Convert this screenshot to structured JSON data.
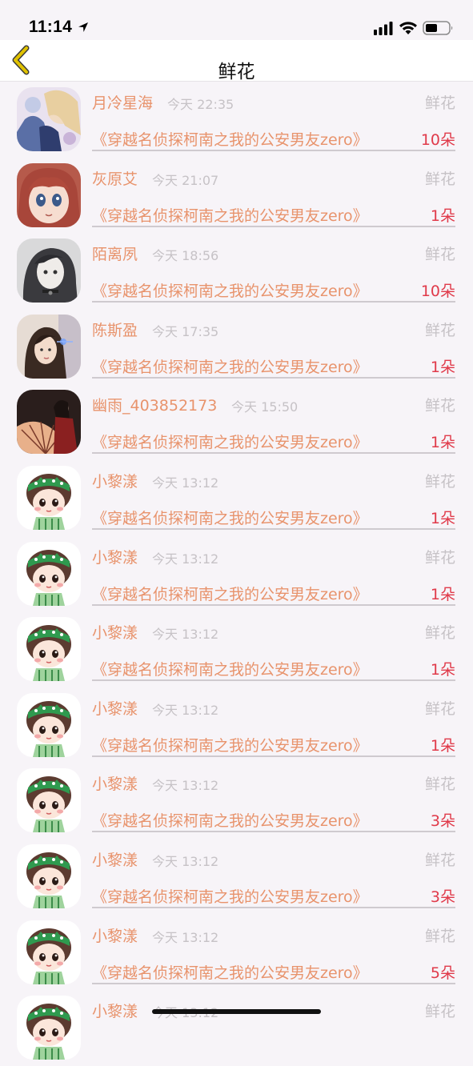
{
  "status_bar": {
    "time": "11:14"
  },
  "nav": {
    "title": "鲜花"
  },
  "rows": [
    {
      "username": "月冷星海",
      "time": "今天 22:35",
      "gift": "鲜花",
      "book": "《穿越名侦探柯南之我的公安男友zero》",
      "quantity": "10朵",
      "avatar": "anime-girl-avatar"
    },
    {
      "username": "灰原艾",
      "time": "今天 21:07",
      "gift": "鲜花",
      "book": "《穿越名侦探柯南之我的公安男友zero》",
      "quantity": "1朵",
      "avatar": "anime-redhead-avatar"
    },
    {
      "username": "陌离夙",
      "time": "今天 18:56",
      "gift": "鲜花",
      "book": "《穿越名侦探柯南之我的公安男友zero》",
      "quantity": "10朵",
      "avatar": "sketch-girl-avatar"
    },
    {
      "username": "陈斯盈",
      "time": "今天 17:35",
      "gift": "鲜花",
      "book": "《穿越名侦探柯南之我的公安男友zero》",
      "quantity": "1朵",
      "avatar": "portrait-girl-avatar"
    },
    {
      "username": "幽雨_403852173",
      "time": "今天 15:50",
      "gift": "鲜花",
      "book": "《穿越名侦探柯南之我的公安男友zero》",
      "quantity": "1朵",
      "avatar": "umbrella-girl-avatar"
    },
    {
      "username": "小黎漾",
      "time": "今天 13:12",
      "gift": "鲜花",
      "book": "《穿越名侦探柯南之我的公安男友zero》",
      "quantity": "1朵",
      "avatar": "cartoon-girl-avatar"
    },
    {
      "username": "小黎漾",
      "time": "今天 13:12",
      "gift": "鲜花",
      "book": "《穿越名侦探柯南之我的公安男友zero》",
      "quantity": "1朵",
      "avatar": "cartoon-girl-avatar"
    },
    {
      "username": "小黎漾",
      "time": "今天 13:12",
      "gift": "鲜花",
      "book": "《穿越名侦探柯南之我的公安男友zero》",
      "quantity": "1朵",
      "avatar": "cartoon-girl-avatar"
    },
    {
      "username": "小黎漾",
      "time": "今天 13:12",
      "gift": "鲜花",
      "book": "《穿越名侦探柯南之我的公安男友zero》",
      "quantity": "1朵",
      "avatar": "cartoon-girl-avatar"
    },
    {
      "username": "小黎漾",
      "time": "今天 13:12",
      "gift": "鲜花",
      "book": "《穿越名侦探柯南之我的公安男友zero》",
      "quantity": "3朵",
      "avatar": "cartoon-girl-avatar"
    },
    {
      "username": "小黎漾",
      "time": "今天 13:12",
      "gift": "鲜花",
      "book": "《穿越名侦探柯南之我的公安男友zero》",
      "quantity": "3朵",
      "avatar": "cartoon-girl-avatar"
    },
    {
      "username": "小黎漾",
      "time": "今天 13:12",
      "gift": "鲜花",
      "book": "《穿越名侦探柯南之我的公安男友zero》",
      "quantity": "5朵",
      "avatar": "cartoon-girl-avatar"
    },
    {
      "username": "小黎漾",
      "time": "今天 13:12",
      "gift": "鲜花",
      "book": "",
      "quantity": "",
      "avatar": "cartoon-girl-avatar"
    }
  ],
  "colors": {
    "username": "#e8936c",
    "book_title": "#e8936c",
    "quantity": "#e03a4a",
    "muted": "#c6c2c6",
    "back_arrow": "#e0c200"
  }
}
